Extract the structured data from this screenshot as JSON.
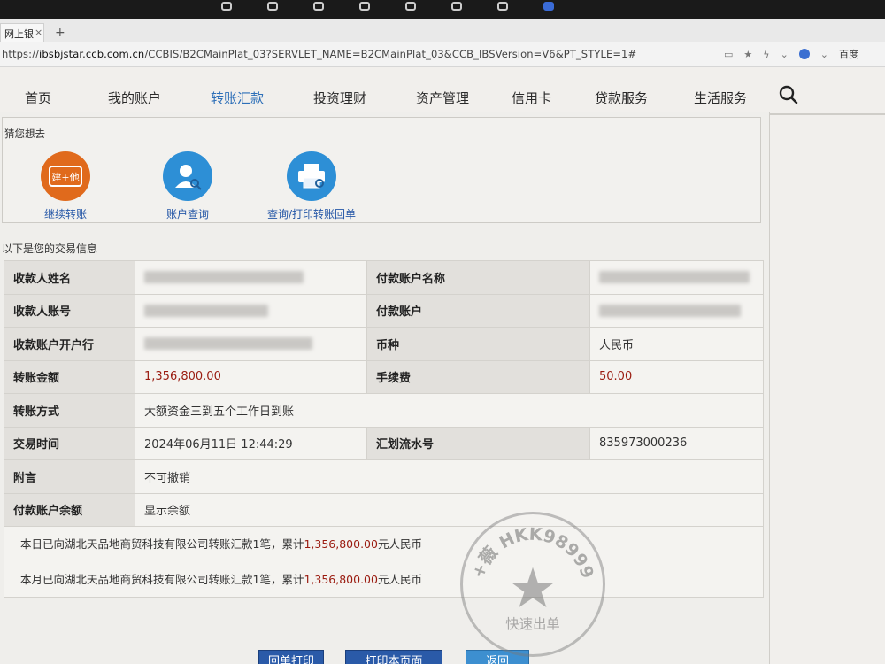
{
  "browser": {
    "tab_title": "网上银",
    "tab_close": "×",
    "new_tab": "+",
    "url_prefix": "https://",
    "url_host": "ibsbjstar.ccb.com.cn",
    "url_path": "/CCBIS/B2CMainPlat_03?SERVLET_NAME=B2CMainPlat_03&CCB_IBSVersion=V6&PT_STYLE=1#",
    "engine_label": "百度",
    "icons": [
      "reader-icon",
      "star-icon",
      "extension-icon",
      "chevron-down-icon"
    ]
  },
  "nav": {
    "items": [
      "首页",
      "我的账户",
      "转账汇款",
      "投资理财",
      "资产管理",
      "信用卡",
      "贷款服务",
      "生活服务"
    ],
    "active_index": 2
  },
  "suggest": {
    "title": "猜您想去",
    "items": [
      {
        "label": "继续转账",
        "icon": "transfer-icon",
        "badge": "建+他",
        "color": "#e06a1c"
      },
      {
        "label": "账户查询",
        "icon": "user-search-icon",
        "color": "#2d8fd6"
      },
      {
        "label": "查询/打印转账回单",
        "icon": "printer-search-icon",
        "color": "#2d8fd6"
      }
    ]
  },
  "info": {
    "title": "以下是您的交易信息",
    "payee_name_label": "收款人姓名",
    "payee_account_label": "收款人账号",
    "payee_bank_label": "收款账户开户行",
    "amount_label": "转账金额",
    "amount_value": "1,356,800.00",
    "method_label": "转账方式",
    "method_value": "大额资金三到五个工作日到账",
    "time_label": "交易时间",
    "time_value": "2024年06月11日 12:44:29",
    "memo_label": "附言",
    "memo_value": "不可撤销",
    "balance_label": "付款账户余额",
    "balance_value": "显示余额",
    "payer_name_label": "付款账户名称",
    "payer_account_label": "付款账户",
    "currency_label": "币种",
    "currency_value": "人民币",
    "fee_label": "手续费",
    "fee_value": "50.00",
    "serial_label": "汇划流水号",
    "serial_value": "835973000236",
    "summary_day_prefix": "本日已向湖北天品地商贸科技有限公司转账汇款1笔，累计",
    "summary_day_amount": "1,356,800.00",
    "summary_day_suffix": "元人民币",
    "summary_month_prefix": "本月已向湖北天品地商贸科技有限公司转账汇款1笔，累计",
    "summary_month_amount": "1,356,800.00",
    "summary_month_suffix": "元人民币"
  },
  "buttons": {
    "receipt_print": "回单打印",
    "print_page": "打印本页面",
    "back": "返回"
  },
  "watermark": {
    "text": "+薇 HKK98999",
    "bottom": "快速出单"
  },
  "colors": {
    "accent_blue": "#2d6fb8",
    "amount_red": "#9a1b10",
    "button_blue": "#2a5aa8"
  }
}
